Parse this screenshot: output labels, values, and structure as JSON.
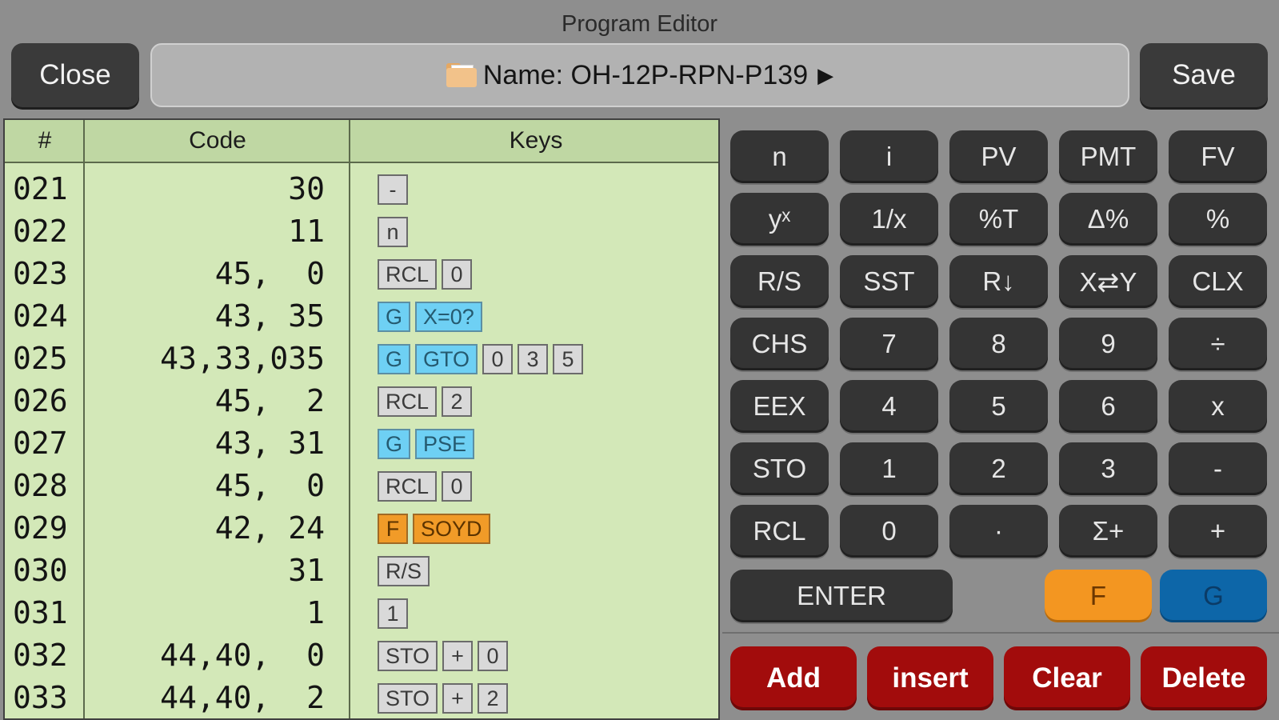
{
  "window": {
    "title": "Program Editor"
  },
  "toolbar": {
    "close_label": "Close",
    "save_label": "Save",
    "name_label": "Name: OH-12P-RPN-P139",
    "name_arrow": "▶"
  },
  "listing": {
    "headers": {
      "num": "#",
      "code": "Code",
      "keys": "Keys"
    },
    "rows": [
      {
        "num": "021",
        "code": "30",
        "keys": [
          {
            "label": "-",
            "type": "plain"
          }
        ]
      },
      {
        "num": "022",
        "code": "11",
        "keys": [
          {
            "label": "n",
            "type": "plain"
          }
        ]
      },
      {
        "num": "023",
        "code": "45,  0",
        "keys": [
          {
            "label": "RCL",
            "type": "plain"
          },
          {
            "label": "0",
            "type": "plain"
          }
        ]
      },
      {
        "num": "024",
        "code": "43, 35",
        "keys": [
          {
            "label": "G",
            "type": "g"
          },
          {
            "label": "X=0?",
            "type": "g"
          }
        ]
      },
      {
        "num": "025",
        "code": "43,33,035",
        "keys": [
          {
            "label": "G",
            "type": "g"
          },
          {
            "label": "GTO",
            "type": "g"
          },
          {
            "label": "0",
            "type": "plain"
          },
          {
            "label": "3",
            "type": "plain"
          },
          {
            "label": "5",
            "type": "plain"
          }
        ]
      },
      {
        "num": "026",
        "code": "45,  2",
        "keys": [
          {
            "label": "RCL",
            "type": "plain"
          },
          {
            "label": "2",
            "type": "plain"
          }
        ]
      },
      {
        "num": "027",
        "code": "43, 31",
        "keys": [
          {
            "label": "G",
            "type": "g"
          },
          {
            "label": "PSE",
            "type": "g"
          }
        ]
      },
      {
        "num": "028",
        "code": "45,  0",
        "keys": [
          {
            "label": "RCL",
            "type": "plain"
          },
          {
            "label": "0",
            "type": "plain"
          }
        ]
      },
      {
        "num": "029",
        "code": "42, 24",
        "keys": [
          {
            "label": "F",
            "type": "f"
          },
          {
            "label": "SOYD",
            "type": "f"
          }
        ]
      },
      {
        "num": "030",
        "code": "31",
        "keys": [
          {
            "label": "R/S",
            "type": "plain"
          }
        ]
      },
      {
        "num": "031",
        "code": "1",
        "keys": [
          {
            "label": "1",
            "type": "plain"
          }
        ]
      },
      {
        "num": "032",
        "code": "44,40,  0",
        "keys": [
          {
            "label": "STO",
            "type": "plain"
          },
          {
            "label": "+",
            "type": "plain"
          },
          {
            "label": "0",
            "type": "plain"
          }
        ]
      },
      {
        "num": "033",
        "code": "44,40,  2",
        "keys": [
          {
            "label": "STO",
            "type": "plain"
          },
          {
            "label": "+",
            "type": "plain"
          },
          {
            "label": "2",
            "type": "plain"
          }
        ]
      }
    ]
  },
  "keypad": {
    "rows": [
      [
        "n",
        "i",
        "PV",
        "PMT",
        "FV"
      ],
      [
        "yˣ",
        "1/x",
        "%T",
        "Δ%",
        "%"
      ],
      [
        "R/S",
        "SST",
        "R↓",
        "X⇄Y",
        "CLX"
      ],
      [
        "CHS",
        "7",
        "8",
        "9",
        "÷"
      ],
      [
        "EEX",
        "4",
        "5",
        "6",
        "x"
      ],
      [
        "STO",
        "1",
        "2",
        "3",
        "-"
      ],
      [
        "RCL",
        "0",
        "·",
        "Σ+",
        "+"
      ]
    ],
    "enter_label": "ENTER",
    "f_label": "F",
    "g_label": "G",
    "colors": {
      "f": "#f39621",
      "g": "#0d66a8"
    }
  },
  "actions": {
    "add": "Add",
    "insert": "insert",
    "clear": "Clear",
    "delete": "Delete"
  },
  "icons": {
    "folder": "folder-icon",
    "arrow": "play-arrow-icon"
  }
}
